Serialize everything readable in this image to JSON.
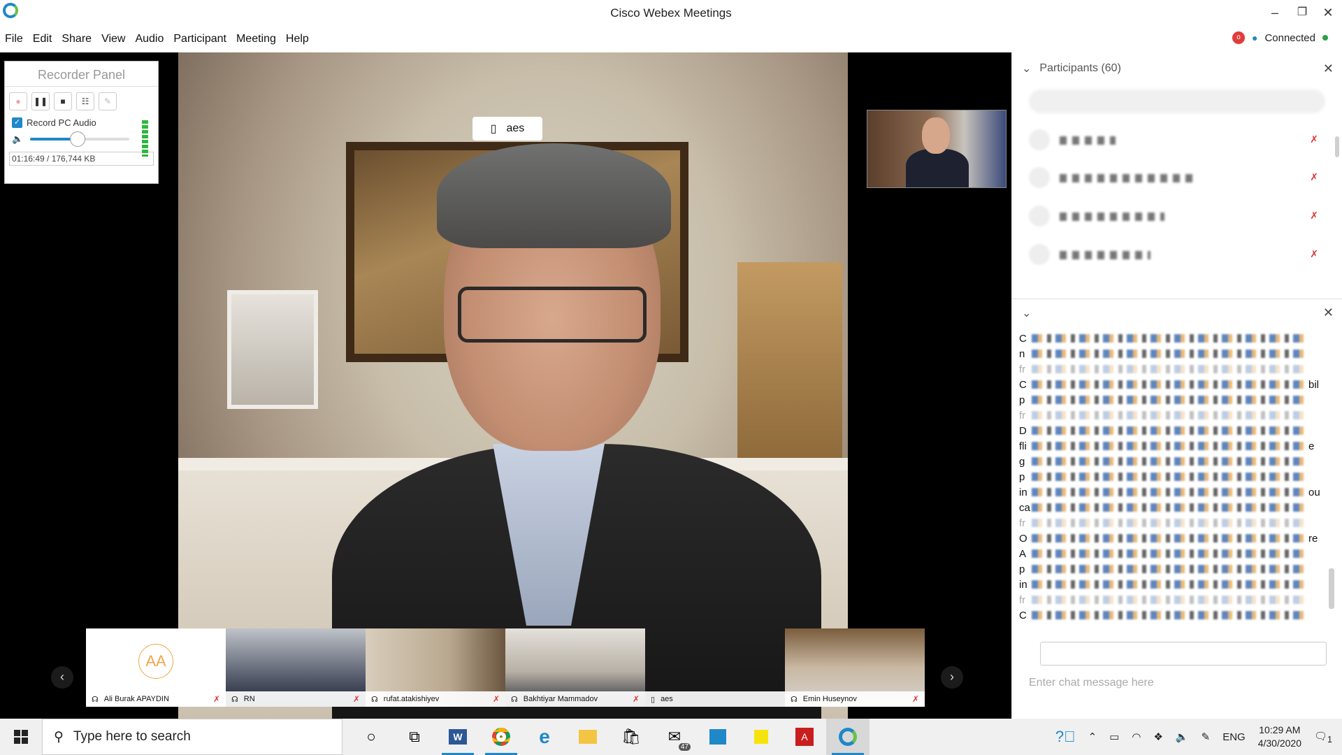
{
  "window": {
    "title": "Cisco Webex Meetings",
    "minimize": "–",
    "restore": "❐",
    "close": "✕"
  },
  "menu": [
    "File",
    "Edit",
    "Share",
    "View",
    "Audio",
    "Participant",
    "Meeting",
    "Help"
  ],
  "status": {
    "rec_indicator": "o",
    "connected": "Connected"
  },
  "recorder": {
    "title": "Recorder Panel",
    "record_pc_audio": "Record PC Audio",
    "volume_fraction": 0.48,
    "status": "01:16:49 / 176,744 KB"
  },
  "main_video": {
    "speaker_tag": "aes"
  },
  "filmstrip": [
    {
      "name": "Ali Burak APAYDIN",
      "initials": "AA",
      "muted": true,
      "has_video": false
    },
    {
      "name": "RN",
      "muted": true,
      "has_video": true
    },
    {
      "name": "rufat.atakishiyev",
      "muted": true,
      "has_video": true
    },
    {
      "name": "Bakhtiyar Mammadov",
      "muted": true,
      "has_video": true
    },
    {
      "name": "aes",
      "muted": false,
      "has_video": true
    },
    {
      "name": "Emin Huseynov",
      "muted": true,
      "has_video": true
    }
  ],
  "participants": {
    "header": "Participants (60)"
  },
  "chat": {
    "initials": [
      "C",
      "n",
      "fr",
      "C",
      "p",
      "fr",
      "D",
      "fli",
      "g",
      "p",
      "in",
      "ca",
      "fr",
      "O",
      "A",
      "p",
      "in",
      "fr",
      "C"
    ],
    "line_endings": [
      "",
      "",
      "",
      "bil",
      "",
      "",
      "",
      "e",
      "",
      "",
      "ou",
      "",
      "",
      "re",
      "",
      "",
      "",
      "",
      ""
    ],
    "input_placeholder": "Enter chat message here"
  },
  "taskbar": {
    "search_placeholder": "Type here to search",
    "mail_badge": "47",
    "language": "ENG",
    "time": "10:29 AM",
    "date": "4/30/2020",
    "notifications": "1"
  }
}
